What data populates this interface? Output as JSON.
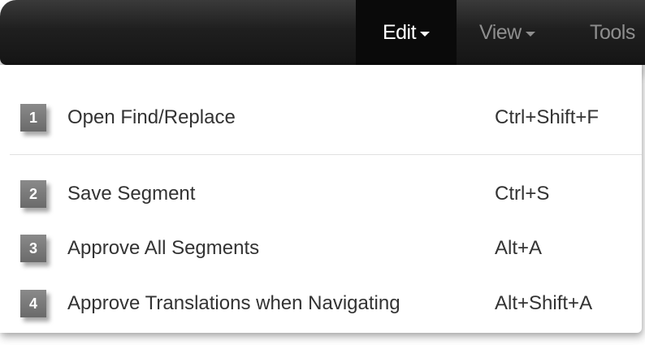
{
  "menubar": {
    "tabs": [
      {
        "label": "Edit",
        "active": true
      },
      {
        "label": "View",
        "active": false
      },
      {
        "label": "Tools",
        "active": false
      }
    ]
  },
  "dropdown": {
    "items": [
      {
        "number": "1",
        "label": "Open Find/Replace",
        "shortcut": "Ctrl+Shift+F"
      },
      {
        "number": "2",
        "label": "Save Segment",
        "shortcut": "Ctrl+S"
      },
      {
        "number": "3",
        "label": "Approve All Segments",
        "shortcut": "Alt+A"
      },
      {
        "number": "4",
        "label": "Approve Translations when Navigating",
        "shortcut": "Alt+Shift+A"
      }
    ]
  },
  "colors": {
    "menubar_bg": "#1f1f1f",
    "active_tab_bg": "#0a0a0a",
    "inactive_tab_text": "#8e8e8e",
    "badge_bg": "#777777",
    "item_text": "#333333"
  }
}
